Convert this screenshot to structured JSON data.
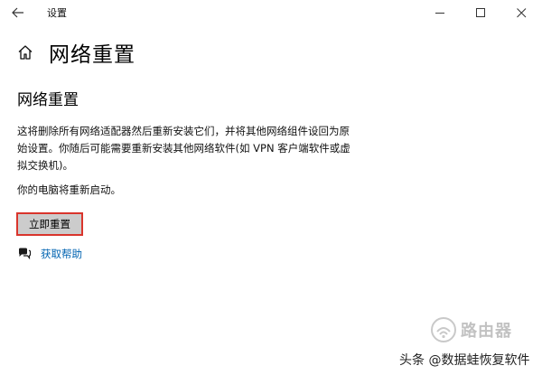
{
  "window": {
    "app_title": "设置"
  },
  "header": {
    "title": "网络重置"
  },
  "section": {
    "title": "网络重置",
    "description": "这将删除所有网络适配器然后重新安装它们，并将其他网络组件设回为原始设置。你随后可能需要重新安装其他网络软件(如 VPN 客户端软件或虚拟交换机)。",
    "restart_note": "你的电脑将重新启动。",
    "reset_button_label": "立即重置"
  },
  "help": {
    "link_label": "获取帮助"
  },
  "watermark": {
    "logo_text": "路由器",
    "credit": "头条 @数据蛙恢复软件"
  },
  "colors": {
    "accent_link": "#0063b1",
    "button_bg": "#cccccc",
    "highlight_border": "#d9352c"
  }
}
